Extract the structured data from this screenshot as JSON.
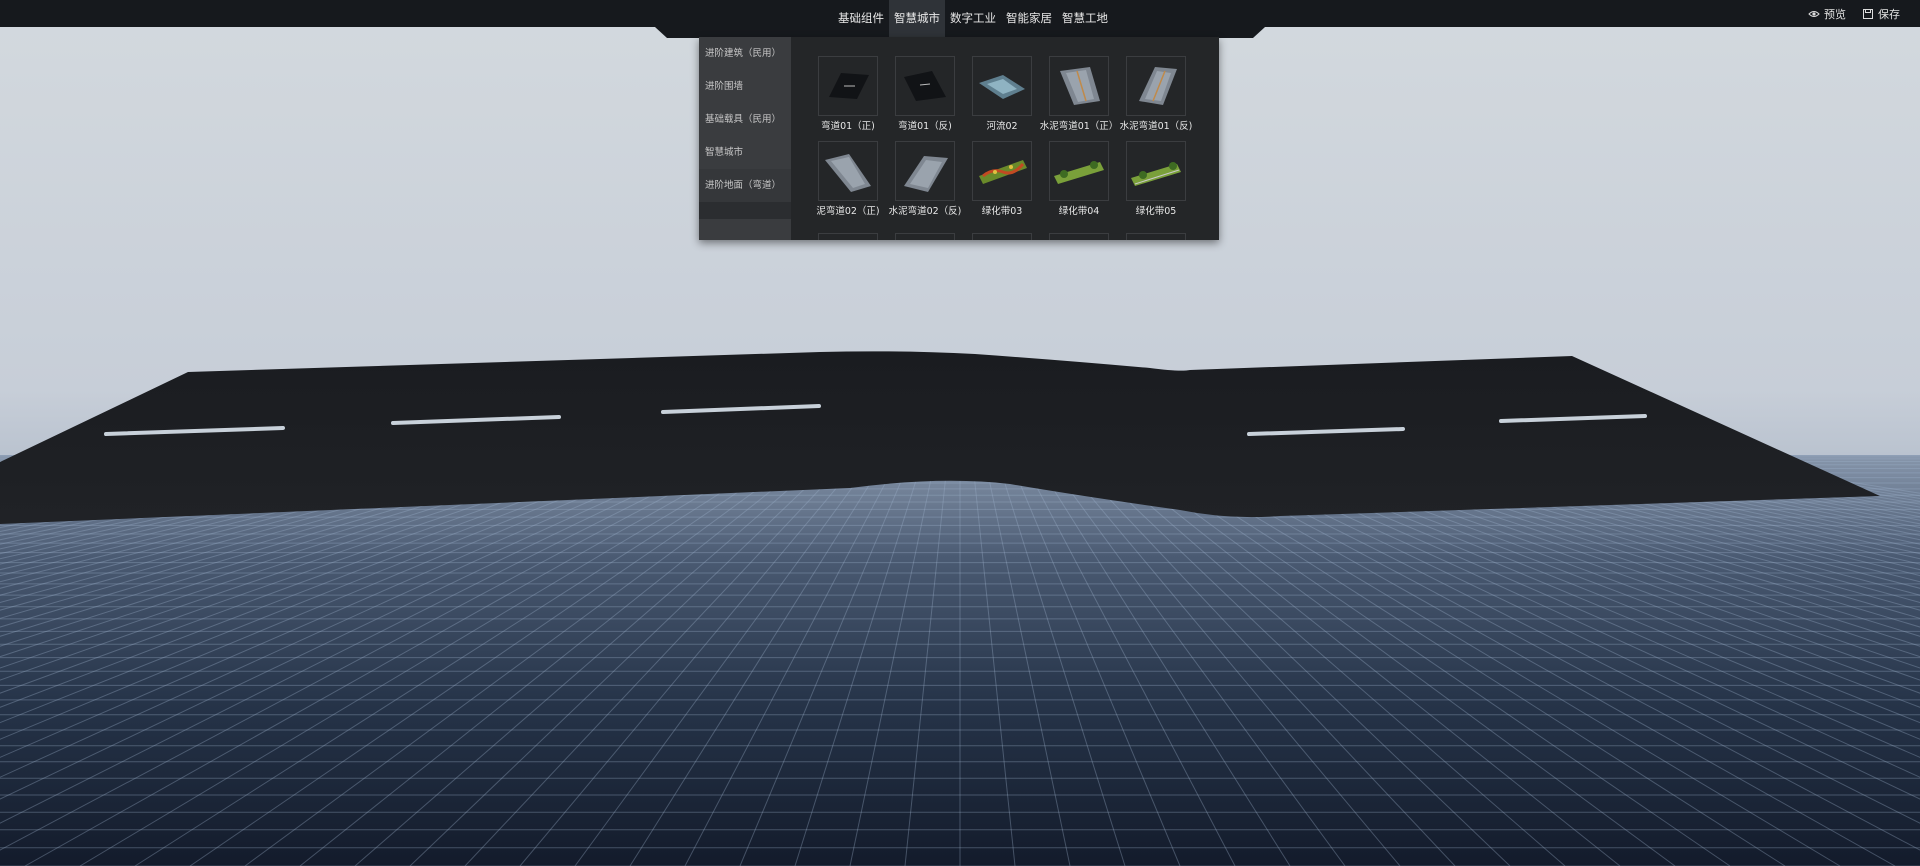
{
  "topbar": {
    "tabs": [
      {
        "label": "基础组件",
        "active": false
      },
      {
        "label": "智慧城市",
        "active": true
      },
      {
        "label": "数字工业",
        "active": false
      },
      {
        "label": "智能家居",
        "active": false
      },
      {
        "label": "智慧工地",
        "active": false
      }
    ],
    "actions": [
      {
        "label": "预览",
        "icon": "eye-icon"
      },
      {
        "label": "保存",
        "icon": "save-icon"
      }
    ]
  },
  "panel": {
    "categories": [
      {
        "label": "进阶建筑（民用）",
        "active": false
      },
      {
        "label": "进阶围墙",
        "active": false
      },
      {
        "label": "基础载具（民用）",
        "active": false
      },
      {
        "label": "智慧城市",
        "active": false
      },
      {
        "label": "进阶地面（弯道）",
        "active": true
      }
    ],
    "items": [
      {
        "label": "弯道01（正)",
        "thumb": "road-dark"
      },
      {
        "label": "弯道01（反)",
        "thumb": "road-dark"
      },
      {
        "label": "河流02",
        "thumb": "river"
      },
      {
        "label": "水泥弯道01（正）",
        "thumb": "concrete"
      },
      {
        "label": "水泥弯道01（反)",
        "thumb": "concrete"
      },
      {
        "label": "泥弯道02（正)",
        "thumb": "concrete"
      },
      {
        "label": "水泥弯道02（反)",
        "thumb": "concrete"
      },
      {
        "label": "绿化带03",
        "thumb": "green-flower"
      },
      {
        "label": "绿化带04",
        "thumb": "green-tree"
      },
      {
        "label": "绿化带05",
        "thumb": "green-tree"
      }
    ]
  },
  "colors": {
    "topbar_bg": "#16191d",
    "panel_bg": "#242628",
    "road": "#1d1f22",
    "lane_marking": "#c9d2dc",
    "grid_floor": "#1d2a3e"
  }
}
